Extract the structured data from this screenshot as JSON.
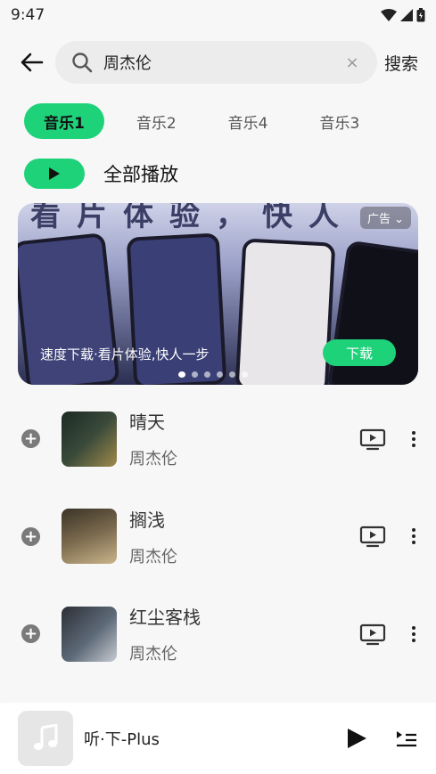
{
  "status": {
    "time": "9:47"
  },
  "search": {
    "query": "周杰伦",
    "submit_label": "搜索"
  },
  "tabs": [
    {
      "label": "音乐1",
      "active": true
    },
    {
      "label": "音乐2",
      "active": false
    },
    {
      "label": "音乐4",
      "active": false
    },
    {
      "label": "音乐3",
      "active": false
    }
  ],
  "play_all": {
    "label": "全部播放"
  },
  "banner": {
    "headline": "看片体验，快人",
    "ad_tag": "广告",
    "caption": "速度下载·看片体验,快人一步",
    "button_label": "下载",
    "slide_count": 6,
    "active_slide": 0
  },
  "songs": [
    {
      "title": "晴天",
      "artist": "周杰伦"
    },
    {
      "title": "搁浅",
      "artist": "周杰伦"
    },
    {
      "title": "红尘客栈",
      "artist": "周杰伦"
    }
  ],
  "player": {
    "title": "听·下-Plus"
  },
  "colors": {
    "accent": "#1ed27a"
  }
}
